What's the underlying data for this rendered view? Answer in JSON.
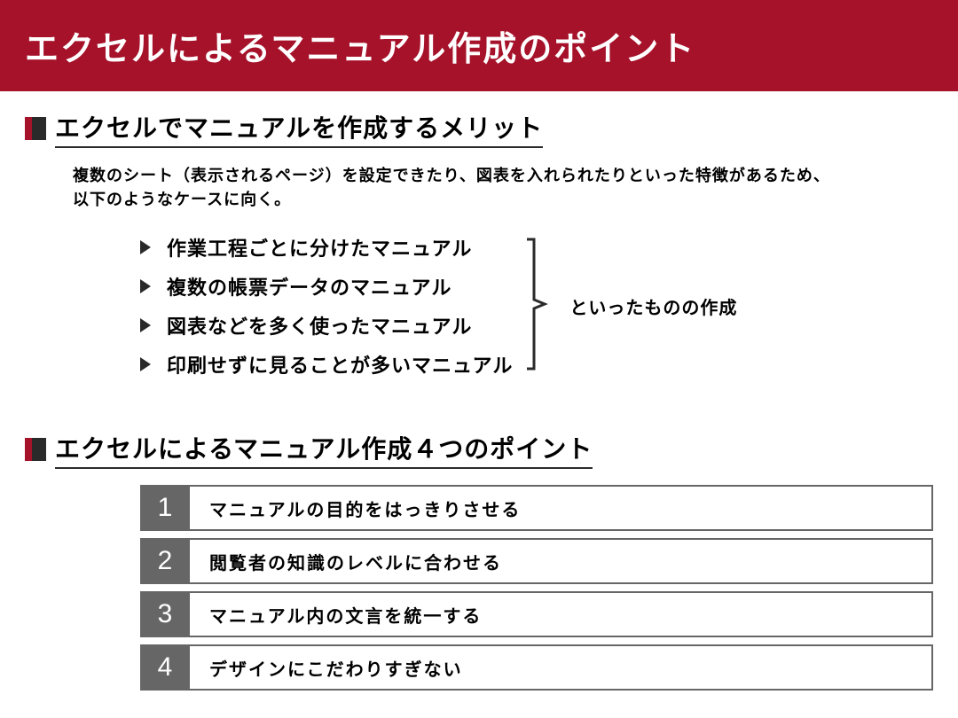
{
  "header": {
    "title": "エクセルによるマニュアル作成のポイント"
  },
  "section1": {
    "heading": "エクセルでマニュアルを作成するメリット",
    "intro_line1": "複数のシート（表示されるページ）を設定できたり、図表を入れられたりといった特徴があるため、",
    "intro_line2": "以下のようなケースに向く。",
    "merits": [
      "作業工程ごとに分けたマニュアル",
      "複数の帳票データのマニュアル",
      "図表などを多く使ったマニュアル",
      "印刷せずに見ることが多いマニュアル"
    ],
    "bracket_note": "といったものの作成"
  },
  "section2": {
    "heading": "エクセルによるマニュアル作成４つのポイント",
    "points": [
      {
        "num": "1",
        "text": "マニュアルの目的をはっきりさせる"
      },
      {
        "num": "2",
        "text": "閲覧者の知識のレベルに合わせる"
      },
      {
        "num": "3",
        "text": "マニュアル内の文言を統一する"
      },
      {
        "num": "4",
        "text": "デザインにこだわりすぎない"
      }
    ]
  }
}
